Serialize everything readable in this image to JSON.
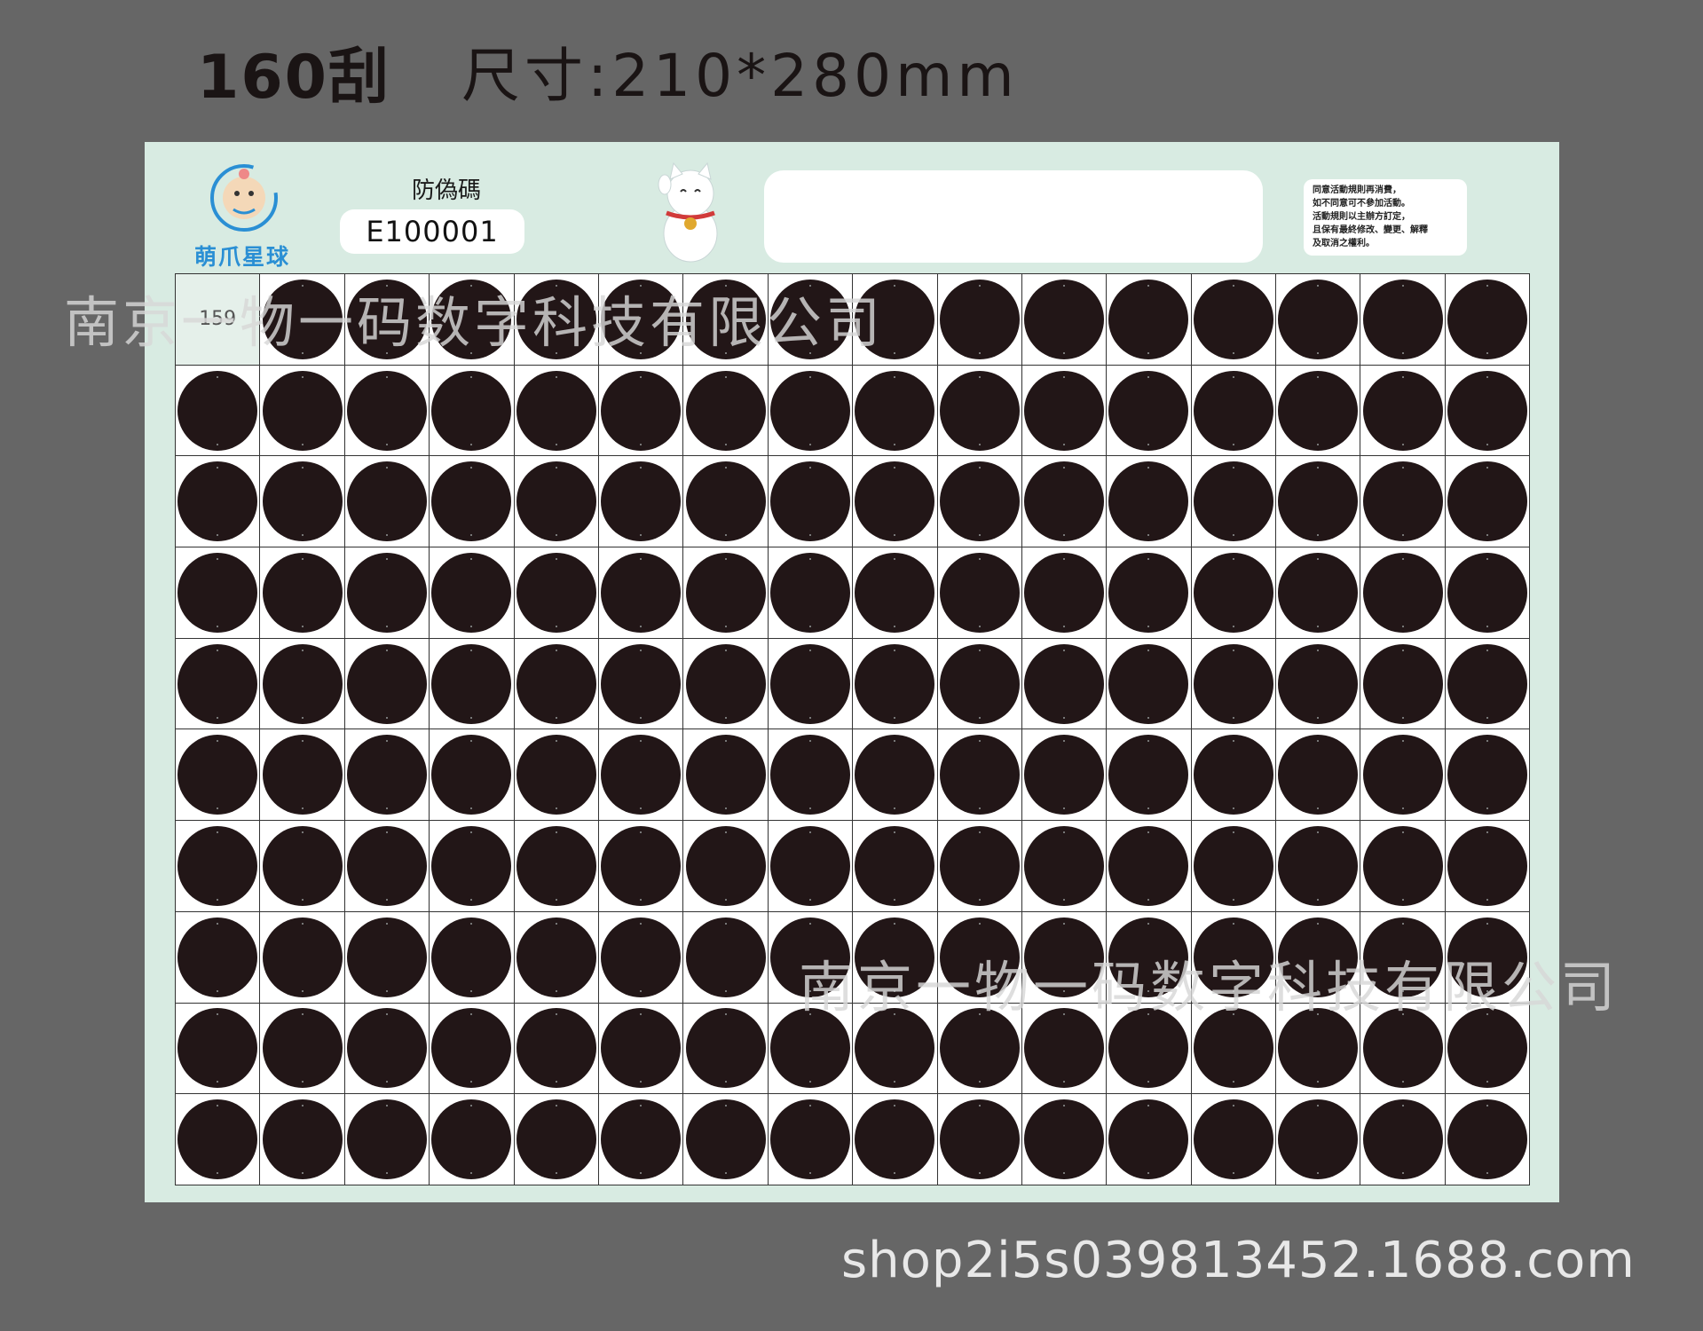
{
  "header": {
    "count_label": "160刮",
    "size_label": "尺寸:210*280mm"
  },
  "card": {
    "logo_text": "萌爪星球",
    "anti_fake_label": "防偽碼",
    "anti_fake_code": "E100001",
    "rules_lines": [
      "同意活動規則再消費，",
      "如不同意可不參加活動。",
      "活動規則以主辦方訂定，",
      "且保有最終修改、變更、解釋",
      "及取消之權利。"
    ],
    "first_cell_number": "159",
    "grid": {
      "rows": 10,
      "cols": 16
    }
  },
  "watermarks": [
    "南京一物一码数字科技有限公司",
    "南京一物一码数字科技有限公司"
  ],
  "footer": {
    "url": "shop2i5s039813452.1688.com"
  },
  "colors": {
    "background": "#666666",
    "card": "#d8ebe2",
    "scratch_dot": "#221617",
    "logo_blue": "#2a8fd4"
  }
}
